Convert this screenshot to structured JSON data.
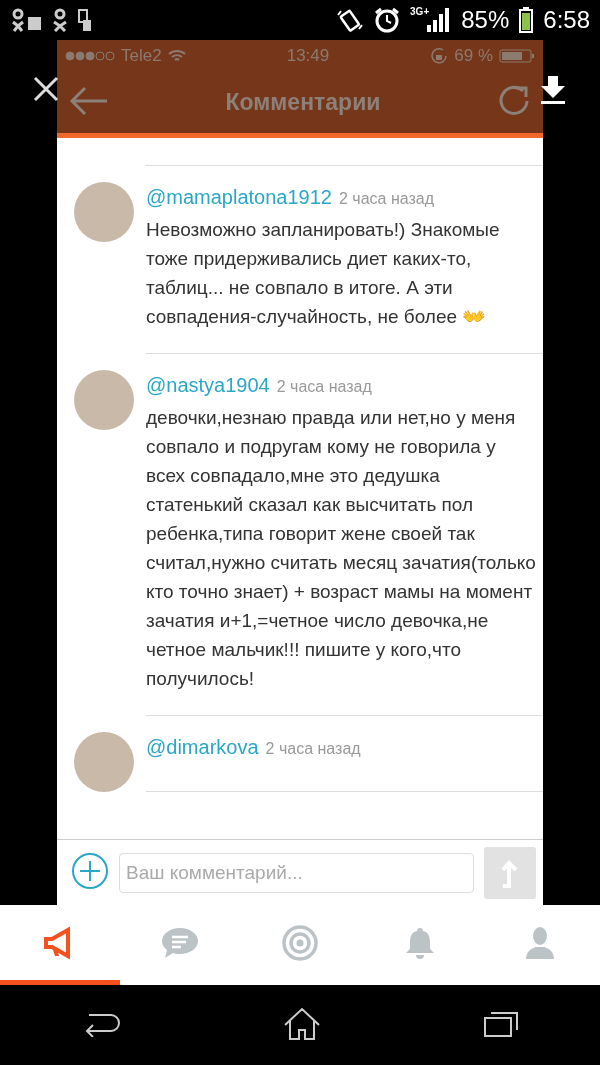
{
  "android_status_bar": {
    "network": "3G+",
    "battery": "85%",
    "time": "6:58"
  },
  "viewer": {
    "ios_status_bar": {
      "carrier": "Tele2",
      "time": "13:49",
      "battery": "69 %"
    },
    "nav_bar": {
      "title": "Комментарии"
    },
    "comments": [
      {
        "user": "@mamaplatona1912",
        "time": "2 часа назад",
        "text": "Невозможно запланировать!) Знакомые тоже придерживались диет каких-то, таблиц... не совпало в итоге. А эти совпадения-случайность, не более 👐"
      },
      {
        "user": "@nastya1904",
        "time": "2 часа назад",
        "text": "девочки,незнаю правда или нет,но у меня совпало и подругам кому не говорила у всех совпадало,мне это дедушка статенький сказал как высчитать пол ребенка,типа говорит жене своей так считал,нужно считать месяц зачатия(только кто точно знает) + возраст мамы на момент зачатия и+1,=четное число девочка,не четное мальчик!!! пишите у кого,что получилось!"
      },
      {
        "user": "@dimarkova",
        "time": "2 часа назад"
      }
    ],
    "comment_input": {
      "placeholder": "Ваш комментарий..."
    }
  },
  "tab_bar": {
    "tabs": [
      {
        "kind": "megaphone",
        "selected": true
      },
      {
        "kind": "chat",
        "selected": false
      },
      {
        "kind": "target",
        "selected": false
      },
      {
        "kind": "bell",
        "selected": false
      },
      {
        "kind": "profile",
        "selected": false
      }
    ]
  }
}
